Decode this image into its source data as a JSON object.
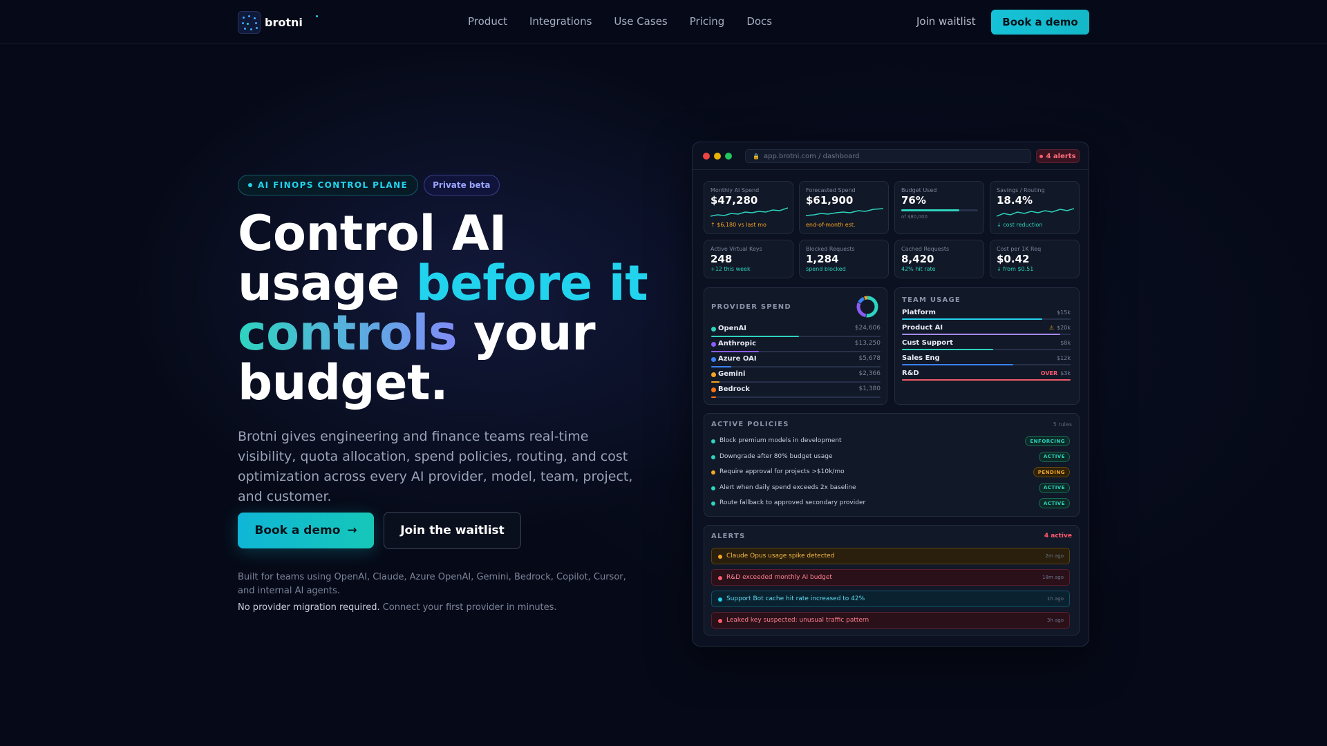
{
  "nav": {
    "brand": "brotni",
    "links": [
      "Product",
      "Integrations",
      "Use Cases",
      "Pricing",
      "Docs"
    ],
    "join": "Join waitlist",
    "demo": "Book a demo"
  },
  "hero": {
    "badge": "AI FINOPS CONTROL PLANE",
    "beta": "Private beta",
    "headline_1": "Control AI",
    "headline_2": "usage ",
    "headline_3": "before it",
    "headline_4": "controls",
    "headline_5": " your",
    "headline_6": "budget.",
    "subcopy": "Brotni gives engineering and finance teams real-time visibility, quota allocation, spend policies, routing, and cost optimization across every AI provider, model, team, project, and customer.",
    "cta_primary": "Book a demo",
    "cta_arrow": "→",
    "cta_secondary": "Join the waitlist",
    "built_for": "Built for teams using OpenAI, Claude, Azure OpenAI, Gemini, Bedrock, Copilot, Cursor, and internal AI agents.",
    "no_migration": "No provider migration required.",
    "connect": "Connect your first provider in minutes."
  },
  "dashboard": {
    "url": "app.brotni.com / dashboard",
    "alerts_pill": "4 alerts",
    "kpis": [
      {
        "label": "Monthly AI Spend",
        "value": "$47,280",
        "sub": "↑ $6,180 vs last mo",
        "tone": "orange"
      },
      {
        "label": "Forecasted Spend",
        "value": "$61,900",
        "sub": "end-of-month est.",
        "tone": "orange"
      },
      {
        "label": "Budget Used",
        "value": "76%",
        "sub": "of $80,000",
        "tone": "muted",
        "progress": 0.76
      },
      {
        "label": "Savings / Routing",
        "value": "18.4%",
        "sub": "↓ cost reduction",
        "tone": "green"
      },
      {
        "label": "Active Virtual Keys",
        "value": "248",
        "sub": "+12 this week",
        "tone": "green"
      },
      {
        "label": "Blocked Requests",
        "value": "1,284",
        "sub": "spend blocked",
        "tone": "green"
      },
      {
        "label": "Cached Requests",
        "value": "8,420",
        "sub": "42% hit rate",
        "tone": "green"
      },
      {
        "label": "Cost per 1K Req",
        "value": "$0.42",
        "sub": "↓ from $0.51",
        "tone": "green"
      }
    ],
    "provider_spend": {
      "title": "PROVIDER SPEND",
      "rows": [
        {
          "name": "OpenAI",
          "amount": "$24,606",
          "share": 0.52,
          "color": "#2dd4bf"
        },
        {
          "name": "Anthropic",
          "amount": "$13,250",
          "share": 0.28,
          "color": "#8b5cf6"
        },
        {
          "name": "Azure OAI",
          "amount": "$5,678",
          "share": 0.12,
          "color": "#3b82f6"
        },
        {
          "name": "Gemini",
          "amount": "$2,366",
          "share": 0.05,
          "color": "#f5a524"
        },
        {
          "name": "Bedrock",
          "amount": "$1,380",
          "share": 0.03,
          "color": "#f97316"
        }
      ]
    },
    "team_usage": {
      "title": "TEAM USAGE",
      "rows": [
        {
          "name": "Platform",
          "amount": "$15k",
          "share": 0.83,
          "color": "#22d3ee",
          "warn": ""
        },
        {
          "name": "Product AI",
          "amount": "$20k",
          "share": 0.94,
          "color": "#a78bfa",
          "warn": "⚠"
        },
        {
          "name": "Cust Support",
          "amount": "$8k",
          "share": 0.54,
          "color": "#2dd4bf",
          "warn": ""
        },
        {
          "name": "Sales Eng",
          "amount": "$12k",
          "share": 0.66,
          "color": "#3b82f6",
          "warn": ""
        },
        {
          "name": "R&D",
          "amount": "$3k",
          "share": 1.0,
          "color": "#f05a6a",
          "warn": "OVER"
        }
      ]
    },
    "policies": {
      "title": "ACTIVE POLICIES",
      "count": "5 rules",
      "rows": [
        {
          "text": "Block premium models in development",
          "status": "ENFORCING",
          "tone": "green"
        },
        {
          "text": "Downgrade after 80% budget usage",
          "status": "ACTIVE",
          "tone": "green"
        },
        {
          "text": "Require approval for projects >$10k/mo",
          "status": "PENDING",
          "tone": "orange"
        },
        {
          "text": "Alert when daily spend exceeds 2x baseline",
          "status": "ACTIVE",
          "tone": "green"
        },
        {
          "text": "Route fallback to approved secondary provider",
          "status": "ACTIVE",
          "tone": "green"
        }
      ]
    },
    "alerts": {
      "title": "ALERTS",
      "count": "4 active",
      "rows": [
        {
          "text": "Claude Opus usage spike detected",
          "time": "2m ago",
          "tone": "orange"
        },
        {
          "text": "R&D exceeded monthly AI budget",
          "time": "18m ago",
          "tone": "red"
        },
        {
          "text": "Support Bot cache hit rate increased to 42%",
          "time": "1h ago",
          "tone": "cyan"
        },
        {
          "text": "Leaked key suspected: unusual traffic pattern",
          "time": "3h ago",
          "tone": "red"
        }
      ]
    }
  },
  "colors": {
    "accent": "#22d3ee",
    "background": "#060a18",
    "warning": "#f5a524",
    "danger": "#f05a6a"
  },
  "icons": [
    "logo-mark-icon",
    "lock-icon",
    "arrow-right-icon",
    "donut-chart-icon"
  ]
}
